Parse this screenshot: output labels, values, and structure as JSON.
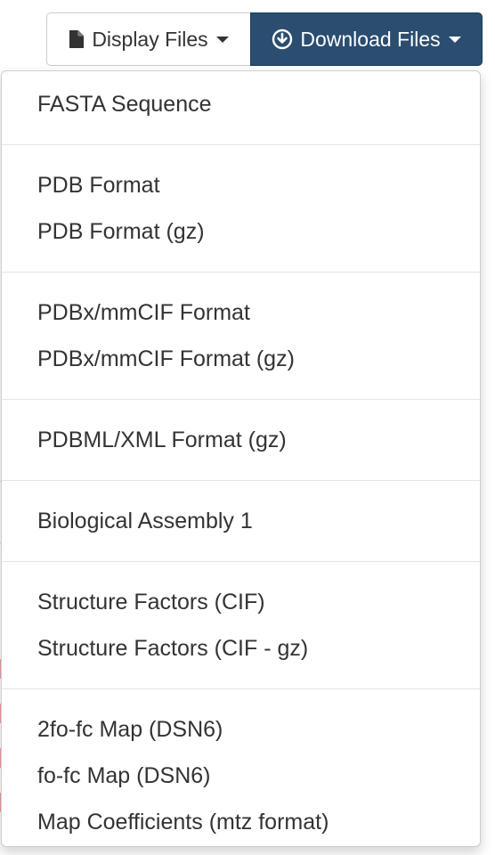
{
  "toolbar": {
    "display_files_label": "Display Files",
    "download_files_label": "Download Files"
  },
  "icons": {
    "display": "file-icon",
    "download": "download-circle-icon",
    "caret": "caret-down-icon"
  },
  "colors": {
    "download_button_bg": "#2a4d70",
    "menu_text": "#333333",
    "divider": "#e5e5e5"
  },
  "dropdown": {
    "groups": [
      {
        "items": [
          "FASTA Sequence"
        ]
      },
      {
        "items": [
          "PDB Format",
          "PDB Format (gz)"
        ]
      },
      {
        "items": [
          "PDBx/mmCIF Format",
          "PDBx/mmCIF Format (gz)"
        ]
      },
      {
        "items": [
          "PDBML/XML Format (gz)"
        ]
      },
      {
        "items": [
          "Biological Assembly 1"
        ]
      },
      {
        "items": [
          "Structure Factors (CIF)",
          "Structure Factors (CIF - gz)"
        ]
      },
      {
        "items": [
          "2fo-fc Map (DSN6)",
          "fo-fc Map (DSN6)",
          "Map Coefficients (mtz format)"
        ]
      }
    ]
  }
}
